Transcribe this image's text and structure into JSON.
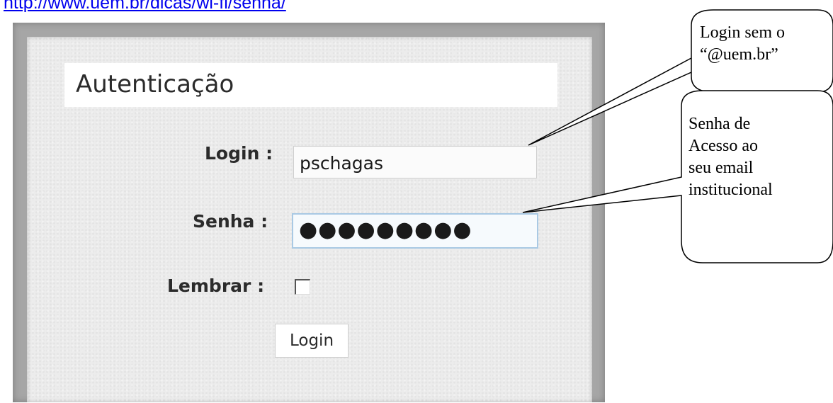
{
  "url": "http://www.uem.br/dicas/wi-fi/senha/",
  "form": {
    "title": "Autenticação",
    "login_label": "Login :",
    "login_value": "pschagas",
    "password_label": "Senha :",
    "password_value": "●●●●●●●●●",
    "remember_label": "Lembrar :",
    "remember_checked": false,
    "submit_label": "Login"
  },
  "callouts": {
    "login_note": [
      "Login sem o",
      "“@uem.br”"
    ],
    "password_note": [
      "Senha de",
      "Acesso ao",
      "seu email",
      "institucional"
    ]
  },
  "colors": {
    "link": "#0000ee",
    "panel_bg": "#ececec",
    "frame": "#a6a6a6",
    "focus_border": "#a9c9e4"
  }
}
